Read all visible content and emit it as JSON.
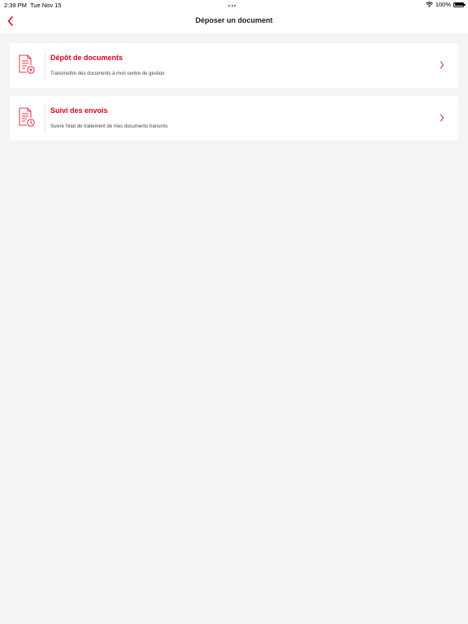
{
  "status_bar": {
    "time": "2:39 PM",
    "date": "Tue Nov 15",
    "battery_text": "100%",
    "icons": [
      "wifi-icon",
      "battery-icon"
    ]
  },
  "nav": {
    "title": "Déposer un document",
    "back_icon": "chevron-left-icon"
  },
  "menu": [
    {
      "title": "Dépôt de documents",
      "subtitle": "Transmettre des documents à mon centre de gestion",
      "icon": "document-add-icon"
    },
    {
      "title": "Suivi des envois",
      "subtitle": "Suivre l'état de traitement de mes documents transmis",
      "icon": "document-history-icon"
    }
  ],
  "colors": {
    "accent": "#d9001b",
    "background": "#f4f4f4",
    "card": "#ffffff"
  }
}
